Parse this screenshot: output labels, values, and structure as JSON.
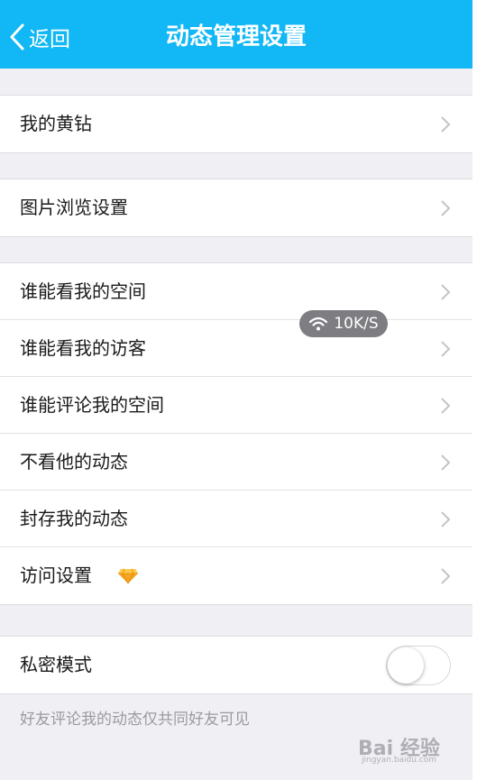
{
  "header": {
    "back_label": "返回",
    "title": "动态管理设置"
  },
  "groups": [
    {
      "items": [
        {
          "label": "我的黄钻"
        }
      ]
    },
    {
      "items": [
        {
          "label": "图片浏览设置"
        }
      ]
    },
    {
      "items": [
        {
          "label": "谁能看我的空间"
        },
        {
          "label": "谁能看我的访客"
        },
        {
          "label": "谁能评论我的空间"
        },
        {
          "label": "不看他的动态"
        },
        {
          "label": "封存我的动态"
        },
        {
          "label": "访问设置"
        }
      ]
    },
    {
      "items": [
        {
          "label": "私密模式",
          "toggle": "off"
        }
      ]
    }
  ],
  "footnote": "好友评论我的动态仅共同好友可见",
  "overlay": {
    "speed": "10K/S"
  },
  "watermark": {
    "brand": "Bai 经验",
    "url": "jingyan.baidu.com"
  },
  "colors": {
    "header_bg": "#12b7f5",
    "diamond": "#f5a623"
  }
}
